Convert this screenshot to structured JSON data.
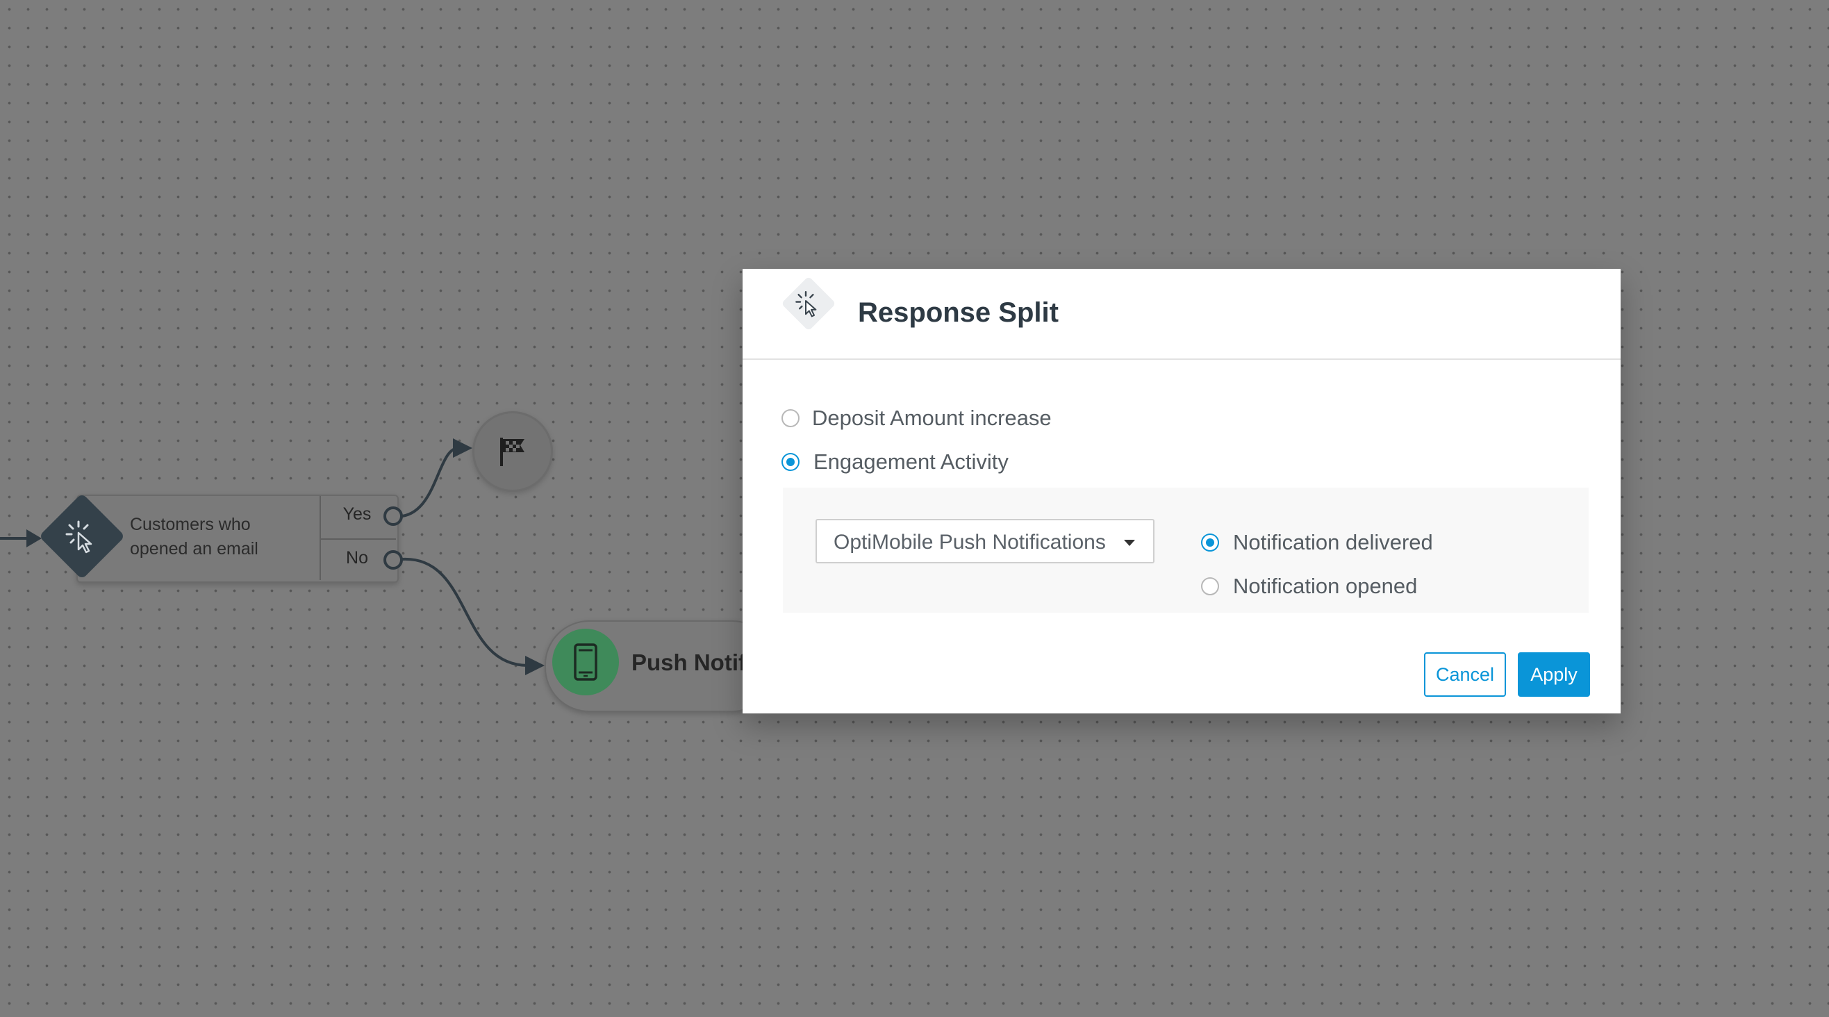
{
  "canvas": {
    "split_node": {
      "label_line1": "Customers who",
      "label_line2": "opened an email",
      "branch_yes": "Yes",
      "branch_no": "No",
      "icon": "click-cursor-icon"
    },
    "end_node": {
      "icon": "checkered-flag-icon"
    },
    "push_node": {
      "label": "Push Notifi",
      "icon": "mobile-phone-icon"
    }
  },
  "dialog": {
    "title": "Response Split",
    "icon": "click-cursor-icon",
    "options": [
      {
        "label": "Deposit Amount increase",
        "checked": false
      },
      {
        "label": "Engagement Activity",
        "checked": true
      }
    ],
    "channel_select": {
      "value": "OptiMobile Push Notifications"
    },
    "activity_options": [
      {
        "label": "Notification delivered",
        "checked": true
      },
      {
        "label": "Notification opened",
        "checked": false
      }
    ],
    "cancel_label": "Cancel",
    "apply_label": "Apply"
  },
  "colors": {
    "accent": "#0a95d8",
    "overlay_background": "#7d7d7d",
    "node_dark": "#34414a",
    "push_green": "#3f8a5a"
  }
}
